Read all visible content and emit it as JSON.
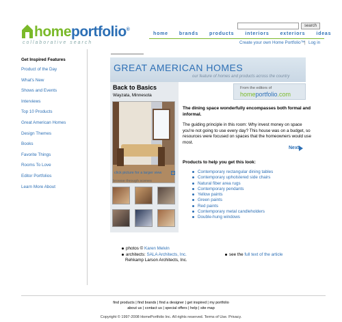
{
  "header": {
    "logo_home": "home",
    "logo_portfolio": "portfolio",
    "logo_reg": "®",
    "logo_tagline": "collaborative search",
    "search_button": "search",
    "nav": [
      "home",
      "brands",
      "products",
      "interiors",
      "exteriors",
      "ideas"
    ],
    "create_link": "Create your own Home Portfolio™",
    "separator": "|",
    "login_link": "Log in"
  },
  "sidebar": {
    "title": "Get Inspired Features",
    "items": [
      "Product of the Day",
      "What's New",
      "Shows and Events",
      "Interviews",
      "Top 10 Products",
      "Great American Homes",
      "Design Themes",
      "Books",
      "Favorite Things",
      "Rooms To Love",
      "Editor Portfolios",
      "Learn More About"
    ]
  },
  "banner": {
    "title": "GREAT AMERICAN HOMES",
    "subtitle": "our feature of homes and products across the country"
  },
  "card": {
    "title": "Back to Basics",
    "location": "Wayzata, Minnesota",
    "larger_link": "click picture for a larger view",
    "zoom_icon": "+",
    "browse": "browse through scenes"
  },
  "editors": {
    "from": "From the editors of",
    "home": "home",
    "portfolio": "portfolio",
    "com": ".com"
  },
  "article": {
    "headline": "The dining space wonderfully encompasses both formal and informal.",
    "body": "The guiding principle in this room: Why invest money on space you're not going to use every day? This house was on a budget, so resources were focused on spaces that the homeowners would use most.",
    "next": "Next",
    "products_title": "Products to help you get this look:",
    "products": [
      "Contemporary rectangular dining tables",
      "Contemporary upholstered side chairs",
      "Natural fiber area rugs",
      "Contemporary pendants",
      "Yellow paints",
      "Green paints",
      "Red paints",
      "Contemporary metal candleholders",
      "Double-hung windows"
    ]
  },
  "credits": {
    "photos_label": "photos",
    "photos_sep": "©",
    "photos_name": "Karen Melvin",
    "architects_label": "architects:",
    "architects_name": "SALA Architects, Inc.",
    "architects_name2": "Rehkamp Larson Architects, Inc.",
    "see": "see the",
    "fulltext_link": "full text of the article"
  },
  "footer": {
    "line1": "find products  |  find brands  |  find a designer  |  get inspired  |  my portfolio",
    "line2": "about us  |  contact us  |  special offers  |  help  |  site map",
    "line3": "Copyright © 1997-2008 HomePortfolio Inc. All rights reserved. Terms of Use. Privacy."
  }
}
